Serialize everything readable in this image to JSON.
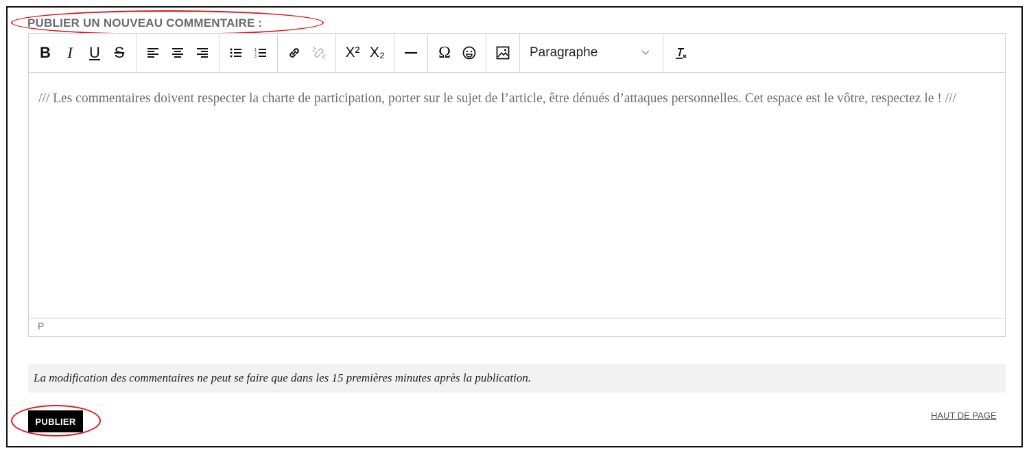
{
  "form": {
    "heading": "PUBLIER UN NOUVEAU COMMENTAIRE :",
    "editor": {
      "toolbar": {
        "text_format": {
          "bold": "B",
          "italic": "I",
          "underline": "U",
          "strikethrough": "S"
        },
        "alignment": [
          "align-left-icon",
          "align-center-icon",
          "align-right-icon"
        ],
        "lists": [
          "bullet-list-icon",
          "numbered-list-icon"
        ],
        "links": [
          "link-icon",
          "unlink-icon"
        ],
        "scripts": {
          "superscript": "X²",
          "subscript": "X₂"
        },
        "insert": [
          "horizontal-rule-icon",
          "omega-icon",
          "smiley-icon",
          "image-icon"
        ],
        "format_select": "Paragraphe",
        "clear_formatting": "clear-formatting-icon"
      },
      "placeholder": "/// Les commentaires doivent respecter la charte de participation, porter sur le sujet de l’article, être dénués d’attaques personnelles. Cet espace est le vôtre, respectez le ! ///",
      "status_path": "P"
    },
    "notice": "La modification des commentaires ne peut se faire que dans les 15 premières minutes après la publication.",
    "submit_label": "PUBLIER",
    "back_to_top_label": "HAUT DE PAGE"
  },
  "colors": {
    "annotation": "#e0141b",
    "heading": "#6a6a6a",
    "button_bg": "#000000",
    "notice_bg": "#f2f2f2"
  }
}
